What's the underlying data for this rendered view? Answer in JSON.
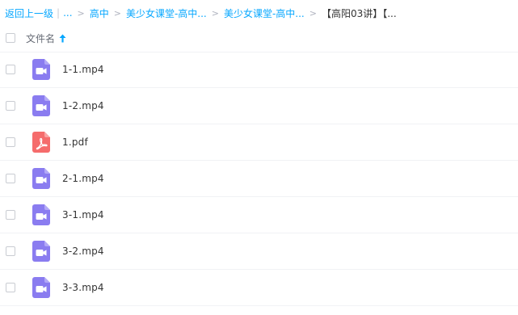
{
  "breadcrumb": {
    "back_label": "返回上一级",
    "ellipsis": "...",
    "items": [
      {
        "label": "高中"
      },
      {
        "label": "美少女课堂-高中..."
      },
      {
        "label": "美少女课堂-高中..."
      }
    ],
    "current": "【高阳03讲】【..."
  },
  "table": {
    "column_name": "文件名",
    "sort_icon": "arrow-up-icon"
  },
  "files": [
    {
      "name": "1-1.mp4",
      "type": "video",
      "icon": "video-file-icon"
    },
    {
      "name": "1-2.mp4",
      "type": "video",
      "icon": "video-file-icon"
    },
    {
      "name": "1.pdf",
      "type": "pdf",
      "icon": "pdf-file-icon"
    },
    {
      "name": "2-1.mp4",
      "type": "video",
      "icon": "video-file-icon"
    },
    {
      "name": "3-1.mp4",
      "type": "video",
      "icon": "video-file-icon"
    },
    {
      "name": "3-2.mp4",
      "type": "video",
      "icon": "video-file-icon"
    },
    {
      "name": "3-3.mp4",
      "type": "video",
      "icon": "video-file-icon"
    }
  ],
  "colors": {
    "accent": "#06a7ff",
    "video_icon": "#8a7cf0",
    "pdf_icon": "#f56c6c"
  }
}
